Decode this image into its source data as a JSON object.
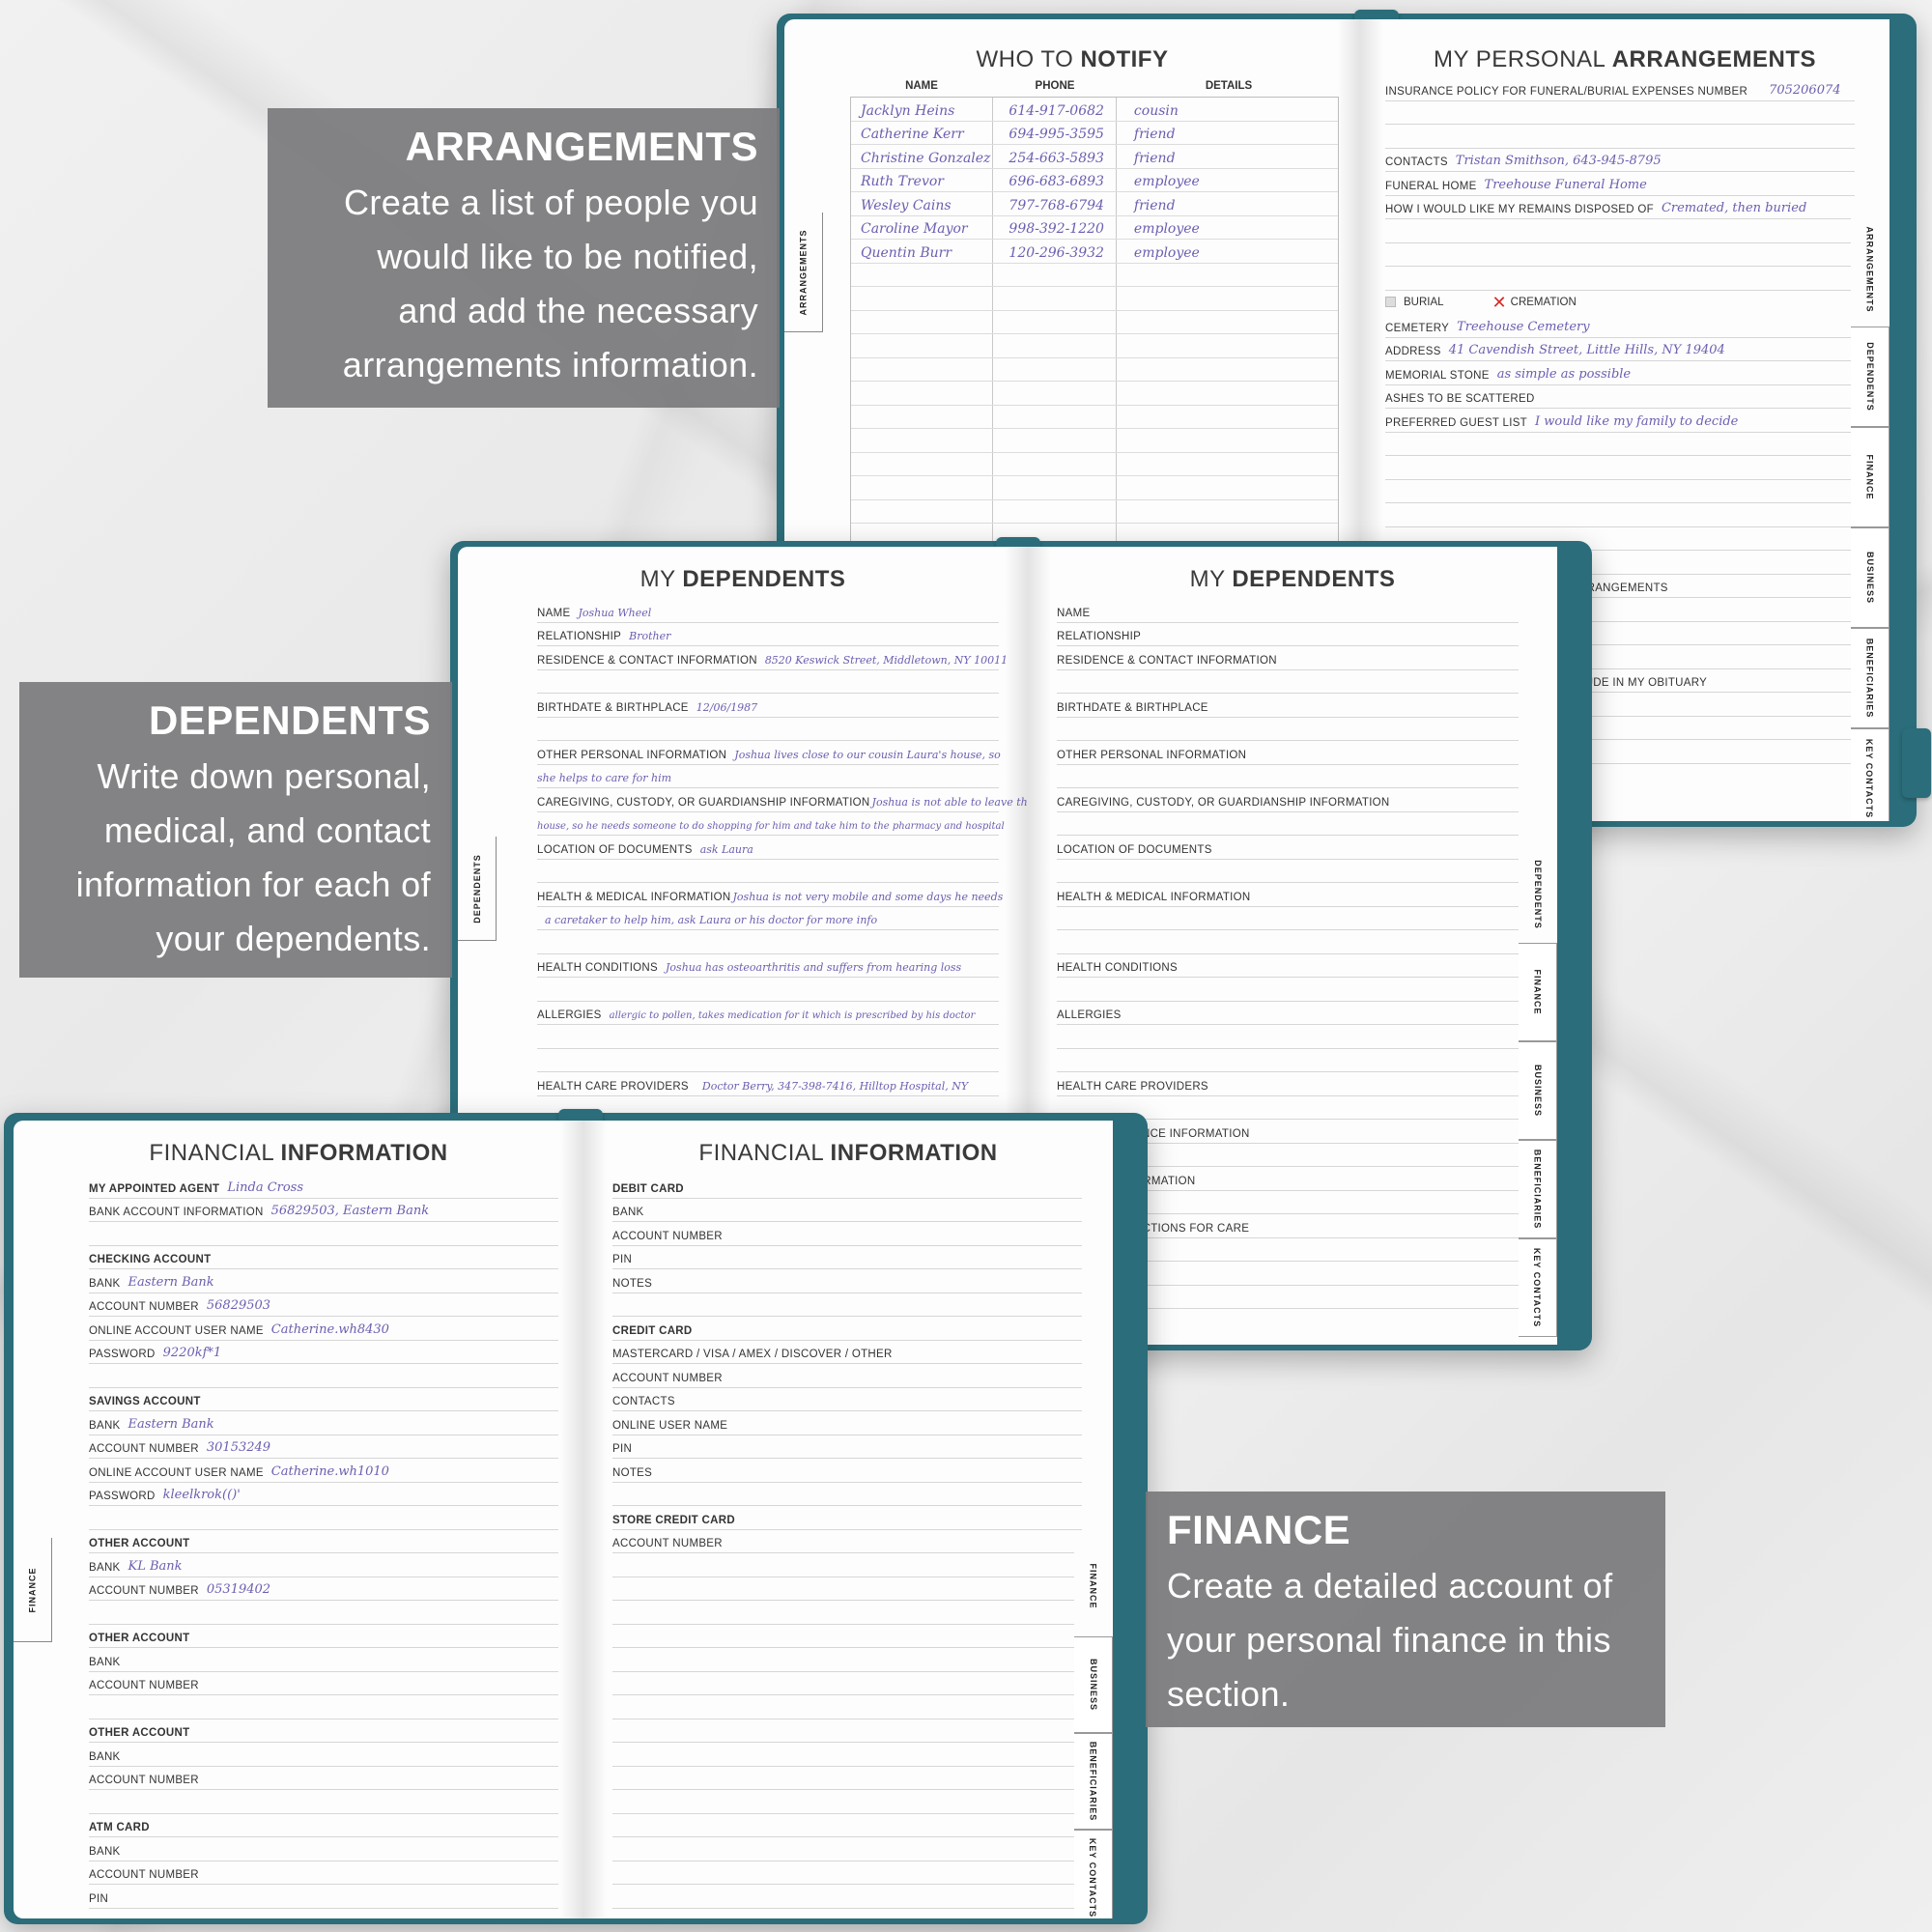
{
  "callouts": {
    "arrangements": {
      "heading": "ARRANGEMENTS",
      "lines": [
        "Create a list of people you",
        "would like to be notified,",
        "and add the necessary",
        "arrangements information."
      ]
    },
    "dependents": {
      "heading": "DEPENDENTS",
      "lines": [
        "Write down personal,",
        "medical, and contact",
        "information for each of",
        "your dependents."
      ]
    },
    "finance": {
      "heading": "FINANCE",
      "lines": [
        "Create a detailed account of",
        "your personal finance in this",
        "section."
      ]
    }
  },
  "book1": {
    "left": {
      "title_light": "WHO TO ",
      "title_bold": "NOTIFY",
      "side_tab": "ARRANGEMENTS",
      "columns": [
        "NAME",
        "PHONE",
        "DETAILS"
      ],
      "rows": [
        [
          "Jacklyn Heins",
          "614-917-0682",
          "cousin"
        ],
        [
          "Catherine Kerr",
          "694-995-3595",
          "friend"
        ],
        [
          "Christine Gonzalez",
          "254-663-5893",
          "friend"
        ],
        [
          "Ruth Trevor",
          "696-683-6893",
          "employee"
        ],
        [
          "Wesley Cains",
          "797-768-6794",
          "friend"
        ],
        [
          "Caroline Mayor",
          "998-392-1220",
          "employee"
        ],
        [
          "Quentin Burr",
          "120-296-3932",
          "employee"
        ]
      ]
    },
    "right": {
      "title_light": "MY PERSONAL ",
      "title_bold": "ARRANGEMENTS",
      "insurance_label": "INSURANCE POLICY FOR FUNERAL/BURIAL EXPENSES NUMBER",
      "insurance_value": "705206074",
      "contacts_label": "CONTACTS",
      "contacts_value": "Tristan Smithson, 643-945-8795",
      "funeral_label": "FUNERAL HOME",
      "funeral_value": "Treehouse Funeral Home",
      "disposed_label": "HOW I WOULD LIKE MY REMAINS DISPOSED OF",
      "disposed_value": "Cremated, then buried",
      "burial_label": "BURIAL",
      "cremation_label": "CREMATION",
      "cemetery_label": "CEMETERY",
      "cemetery_value": "Treehouse Cemetery",
      "address_label": "ADDRESS",
      "address_value": "41 Cavendish Street, Little Hills, NY 19404",
      "stone_label": "MEMORIAL STONE",
      "stone_value": "as simple as possible",
      "ashes_label": "ASHES TO BE SCATTERED",
      "guest_label": "PREFERRED GUEST LIST",
      "guest_value": "I would like my family to decide",
      "partial1": "RRANGEMENTS",
      "partial2": "LUDE IN MY OBITUARY",
      "tabs": [
        "ARRANGEMENTS",
        "DEPENDENTS",
        "FINANCE",
        "BUSINESS",
        "BENEFICIARIES",
        "KEY CONTACTS"
      ]
    }
  },
  "book2": {
    "left": {
      "title_light": "MY ",
      "title_bold": "DEPENDENTS",
      "side_tab": "DEPENDENTS",
      "name_label": "NAME",
      "name_value": "Joshua Wheel",
      "relationship_label": "RELATIONSHIP",
      "relationship_value": "Brother",
      "residence_label": "RESIDENCE & CONTACT INFORMATION",
      "residence_value": "8520 Keswick Street, Middletown, NY 10011",
      "birth_label": "BIRTHDATE & BIRTHPLACE",
      "birth_value": "12/06/1987",
      "other_label": "OTHER PERSONAL INFORMATION",
      "other_value": "Joshua lives close to our cousin Laura's house, so",
      "other_value2": "she helps to care for him",
      "care_label": "CAREGIVING, CUSTODY, OR GUARDIANSHIP INFORMATION",
      "care_value": "Joshua is not able to leave the",
      "care_value2": "house, so he needs someone to do shopping for him and take him to the pharmacy and hospital",
      "location_label": "LOCATION OF DOCUMENTS",
      "location_value": "ask Laura",
      "health_label": "HEALTH & MEDICAL INFORMATION",
      "health_value": "Joshua is not very mobile and some days he needs",
      "health_value2": "a caretaker to help him, ask Laura or his doctor for more info",
      "conditions_label": "HEALTH CONDITIONS",
      "conditions_value": "Joshua has osteoarthritis and suffers from hearing loss",
      "allergies_label": "ALLERGIES",
      "allergies_value": "allergic to pollen, takes medication for it which is prescribed by his doctor",
      "providers_label": "HEALTH CARE PROVIDERS",
      "providers_value": "Doctor Berry, 347-398-7416, Hilltop Hospital, NY"
    },
    "right": {
      "title_light": "MY ",
      "title_bold": "DEPENDENTS",
      "labels": [
        "NAME",
        "RELATIONSHIP",
        "RESIDENCE & CONTACT INFORMATION",
        "BIRTHDATE & BIRTHPLACE",
        "OTHER PERSONAL INFORMATION",
        "CAREGIVING, CUSTODY, OR GUARDIANSHIP INFORMATION",
        "LOCATION OF DOCUMENTS",
        "HEALTH & MEDICAL INFORMATION",
        "HEALTH CONDITIONS",
        "ALLERGIES",
        "HEALTH CARE PROVIDERS"
      ],
      "partial1": "ANCE INFORMATION",
      "partial2": "ORMATION",
      "partial3": "UCTIONS FOR CARE",
      "tabs": [
        "DEPENDENTS",
        "FINANCE",
        "BUSINESS",
        "BENEFICIARIES",
        "KEY CONTACTS"
      ]
    }
  },
  "book3": {
    "left": {
      "title_light": "FINANCIAL ",
      "title_bold": "INFORMATION",
      "side_tab": "FINANCE",
      "agent_label": "MY APPOINTED AGENT",
      "agent_value": "Linda Cross",
      "bankinfo_label": "BANK ACCOUNT INFORMATION",
      "bankinfo_value": "56829503, Eastern Bank",
      "checking_label": "CHECKING ACCOUNT",
      "bank_label": "BANK",
      "acct_label": "ACCOUNT NUMBER",
      "user_label": "ONLINE ACCOUNT USER NAME",
      "pass_label": "PASSWORD",
      "pin_label": "PIN",
      "checking_bank": "Eastern Bank",
      "checking_acct": "56829503",
      "checking_user": "Catherine.wh8430",
      "checking_pass": "9220kf*1",
      "savings_label": "SAVINGS ACCOUNT",
      "savings_bank": "Eastern Bank",
      "savings_acct": "30153249",
      "savings_user": "Catherine.wh1010",
      "savings_pass": "kleelkrok(()'",
      "other_label": "OTHER ACCOUNT",
      "other_bank": "KL Bank",
      "other_acct": "05319402",
      "atm_label": "ATM CARD"
    },
    "right": {
      "title_light": "FINANCIAL ",
      "title_bold": "INFORMATION",
      "debit_label": "DEBIT CARD",
      "bank_label": "BANK",
      "acct_label": "ACCOUNT NUMBER",
      "pin_label": "PIN",
      "notes_label": "NOTES",
      "credit_label": "CREDIT CARD",
      "cardtype_label": "MASTERCARD / VISA / AMEX / DISCOVER / OTHER",
      "contacts_label": "CONTACTS",
      "user_label": "ONLINE USER NAME",
      "store_label": "STORE CREDIT CARD",
      "tabs": [
        "FINANCE",
        "BUSINESS",
        "BENEFICIARIES",
        "KEY CONTACTS"
      ]
    }
  }
}
